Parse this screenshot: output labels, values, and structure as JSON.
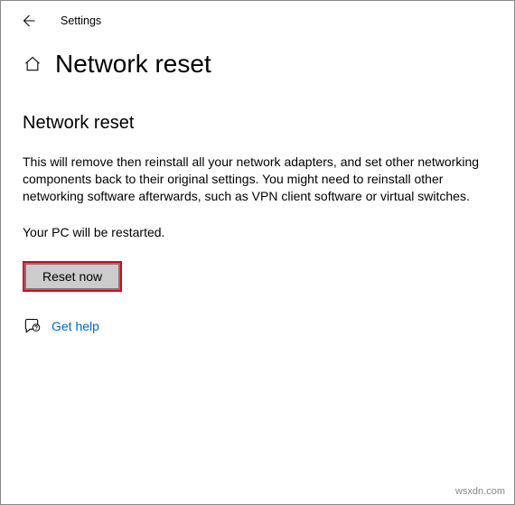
{
  "titlebar": {
    "app_name": "Settings"
  },
  "header": {
    "page_title": "Network reset"
  },
  "main": {
    "subheading": "Network reset",
    "description": "This will remove then reinstall all your network adapters, and set other networking components back to their original settings. You might need to reinstall other networking software afterwards, such as VPN client software or virtual switches.",
    "restart_note": "Your PC will be restarted.",
    "reset_button_label": "Reset now",
    "help_link_label": "Get help"
  },
  "watermark": "wsxdn.com"
}
